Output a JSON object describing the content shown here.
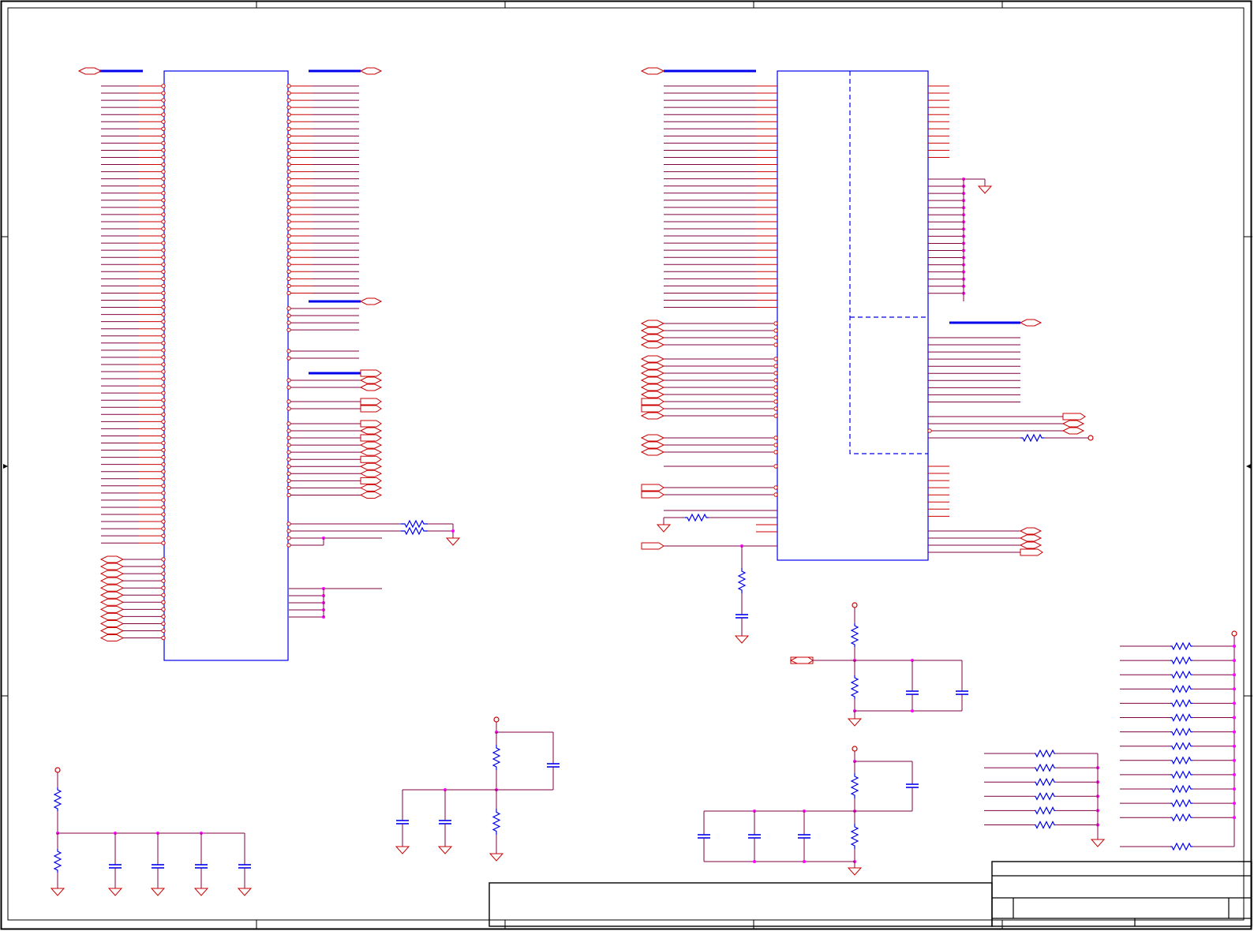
{
  "document": {
    "type": "electrical-schematic-sheet",
    "title_block": {
      "title": "",
      "document_number": "",
      "revision": "",
      "sheet": "",
      "date": ""
    },
    "notes_panel": ""
  },
  "colors": {
    "background": "#ffffff",
    "border": "#000000",
    "wire": "#cc0000",
    "net_wire": "#800040",
    "component_body": "#0000ee",
    "bus": "#0000ee",
    "junction": "#ff00ff",
    "power_port": "#cc0000"
  },
  "components": {
    "left_ic_pin_count": 77,
    "right_ic_pin_count": 70,
    "resistors": 30,
    "capacitors": 13,
    "ground_symbols": 16,
    "power_symbols": 5
  }
}
